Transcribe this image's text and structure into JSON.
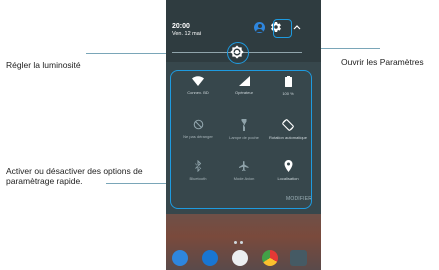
{
  "callouts": {
    "brightness": "Régler la luminosité",
    "settings": "Ouvrir les Paramètres",
    "toggles": "Activer ou désactiver des options de paramètrage rapide."
  },
  "status": {
    "time": "20:00",
    "date": "Ven. 12 mai"
  },
  "header_icons": [
    "avatar-icon",
    "gear-icon",
    "chevron-up-icon"
  ],
  "tiles": [
    {
      "label": "Connex. BD",
      "icon": "wifi-icon",
      "state": "on"
    },
    {
      "label": "Opérateur",
      "icon": "signal-icon",
      "state": "on"
    },
    {
      "label": "100 %",
      "icon": "battery-icon",
      "state": "on"
    },
    {
      "label": "Ne pas déranger",
      "icon": "do-not-disturb-icon",
      "state": "off"
    },
    {
      "label": "Lampe de poche",
      "icon": "flashlight-icon",
      "state": "off"
    },
    {
      "label": "Rotation automatique",
      "icon": "auto-rotate-icon",
      "state": "on"
    },
    {
      "label": "Bluetooth",
      "icon": "bluetooth-icon",
      "state": "off"
    },
    {
      "label": "Mode Avion",
      "icon": "airplane-icon",
      "state": "off"
    },
    {
      "label": "Localisation",
      "icon": "location-icon",
      "state": "on"
    }
  ],
  "modify_label": "MODIFIER",
  "colors": {
    "highlight": "#1e9be0",
    "shade": "#37474c",
    "header": "#2f3c40",
    "avatar": "#2e86de"
  },
  "dock_icons": [
    "phone-icon",
    "messages-icon",
    "apps-icon",
    "chrome-icon",
    "camera-icon"
  ]
}
